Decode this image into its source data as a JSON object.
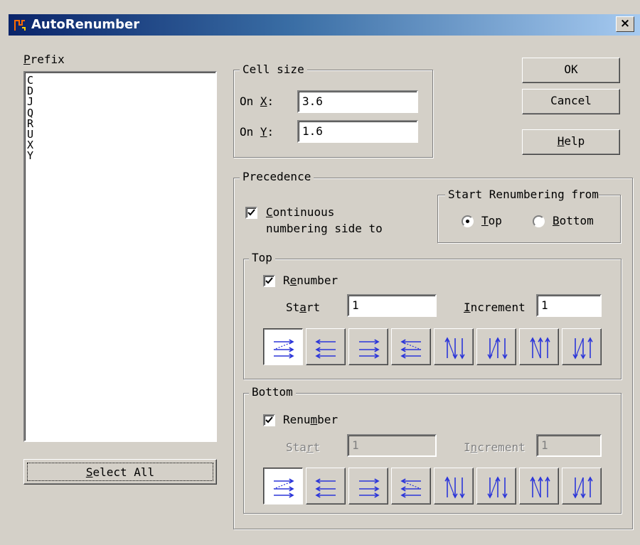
{
  "window": {
    "title": "AutoRenumber",
    "close_glyph": "×"
  },
  "prefix": {
    "label_u": "P",
    "label_rest": "refix",
    "items": [
      "C",
      "D",
      "J",
      "Q",
      "R",
      "U",
      "X",
      "Y"
    ]
  },
  "select_all": {
    "u": "S",
    "rest": "elect All"
  },
  "cell_size": {
    "title": "Cell size",
    "x": {
      "pre": "On ",
      "u": "X",
      "post": ":",
      "value": "3.6"
    },
    "y": {
      "pre": "On ",
      "u": "Y",
      "post": ":",
      "value": "1.6"
    }
  },
  "buttons": {
    "ok": "OK",
    "cancel": "Cancel",
    "help_u": "H",
    "help_rest": "elp"
  },
  "precedence": {
    "title": "Precedence",
    "continuous": {
      "checked": true,
      "u": "C",
      "line1_rest": "ontinuous",
      "line2": "numbering side to"
    },
    "start_from": {
      "title": "Start Renumbering from",
      "top_u": "T",
      "top_rest": "op",
      "bottom_u": "B",
      "bottom_rest": "ottom",
      "selected": "Top"
    }
  },
  "top": {
    "title": "Top",
    "renumber": {
      "checked": true,
      "pre": "R",
      "u": "e",
      "post": "number"
    },
    "start": {
      "pre": "St",
      "u": "a",
      "post": "rt",
      "value": "1"
    },
    "increment": {
      "u": "I",
      "post": "ncrement",
      "value": "1"
    }
  },
  "bottom": {
    "title": "Bottom",
    "renumber": {
      "checked": true,
      "pre": "Renu",
      "u": "m",
      "post": "ber"
    },
    "start": {
      "pre": "Sta",
      "u": "r",
      "post": "t",
      "value": "1",
      "disabled": true
    },
    "increment": {
      "pre": "I",
      "u": "n",
      "post": "crement",
      "value": "1",
      "disabled": true
    }
  },
  "order_icons": [
    "rows-left-right-zigzag-icon",
    "rows-right-left-icon",
    "rows-left-right-icon",
    "rows-right-left-zigzag-icon",
    "cols-up-down-icon",
    "cols-down-up-icon",
    "cols-up-icon",
    "cols-down-icon"
  ],
  "colors": {
    "accent": "#0a246a",
    "arrow": "#2b35d9",
    "face": "#d4d0c8"
  }
}
